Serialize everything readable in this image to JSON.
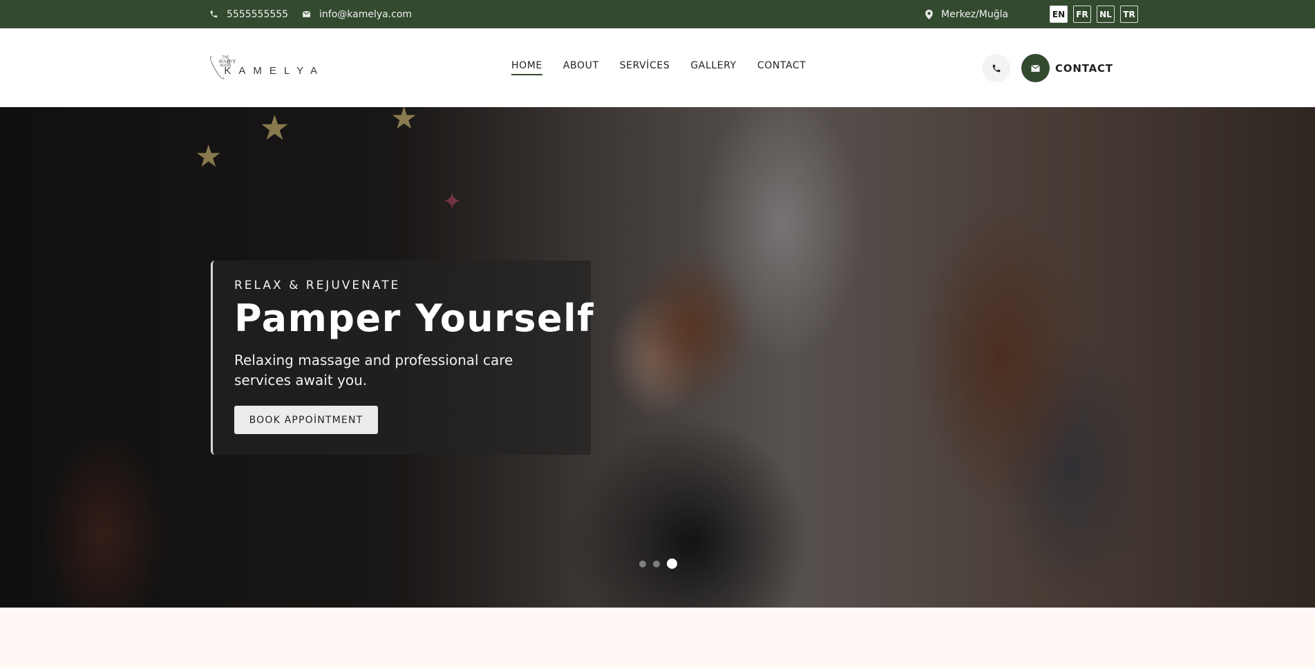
{
  "topbar": {
    "phone": "5555555555",
    "email": "info@kamelya.com",
    "location": "Merkez/Muğla",
    "languages": [
      "EN",
      "FR",
      "NL",
      "TR"
    ],
    "active_language": "EN"
  },
  "logo": {
    "inner": "THE BEAUTY ROOM",
    "by": "BY",
    "name": "KAMELYA"
  },
  "nav": {
    "items": [
      "HOME",
      "ABOUT",
      "SERVİCES",
      "GALLERY",
      "CONTACT"
    ],
    "active": "HOME"
  },
  "header": {
    "contact_label": "CONTACT"
  },
  "hero": {
    "subtitle": "RELAX & REJUVENATE",
    "title": "Pamper Yourself",
    "description": "Relaxing massage and professional care services await you.",
    "button": "BOOK APPOİNTMENT",
    "slides": 3,
    "active_slide": 3
  },
  "colors": {
    "brand_green": "#334a2f",
    "page_bg": "#fff8f4"
  }
}
